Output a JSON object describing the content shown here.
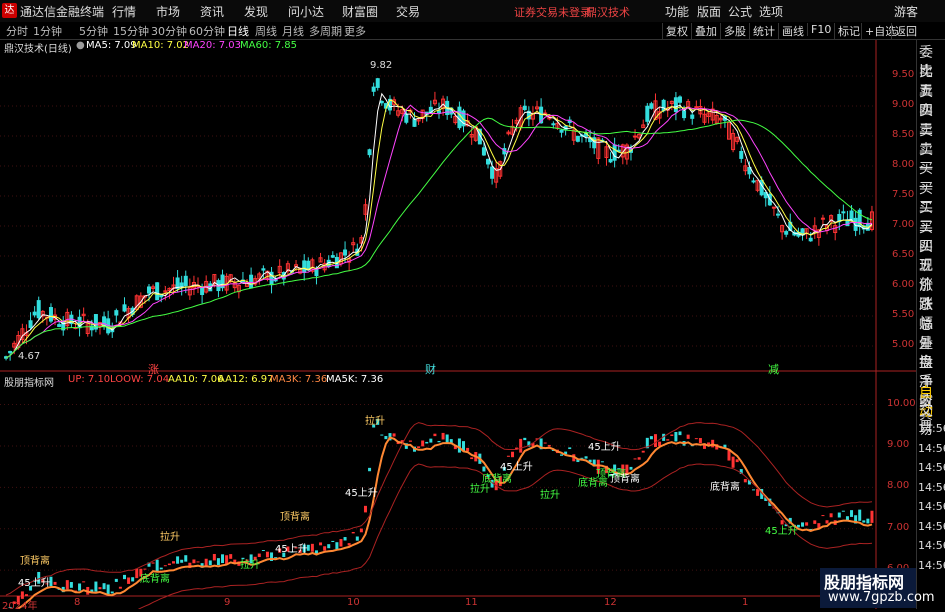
{
  "menubar": {
    "title": "通达信金融终端",
    "items": [
      "行情",
      "市场",
      "资讯",
      "发现",
      "问小达",
      "财富圈",
      "交易"
    ],
    "warning": "证券交易未登录",
    "brand": "鼎汉技术",
    "right_items": [
      "功能",
      "版面",
      "公式",
      "选项",
      "游客"
    ]
  },
  "toolbar": {
    "timeframes": [
      "分时",
      "1分钟",
      "5分钟",
      "15分钟",
      "30分钟",
      "60分钟",
      "日线",
      "周线",
      "月线",
      "多周期",
      "更多"
    ],
    "active": "日线",
    "buttons": [
      "复权",
      "叠加",
      "多股",
      "统计",
      "画线",
      "F10",
      "标记",
      "+自选",
      "返回"
    ]
  },
  "main_legend": {
    "stock": "鼎汉技术(日线)",
    "ma5": "MA5: 7.09",
    "ma10": "MA10: 7.02",
    "ma20": "MA20: 7.03",
    "ma60": "MA60: 7.85"
  },
  "sub_legend": {
    "name": "股朋指标网",
    "up": "UP: 7.10",
    "loow": "LOOW: 7.04",
    "aa10": "AA10: 7.06",
    "aa12": "AA12: 6.97",
    "ma3k": "MA3K: 7.36",
    "ma5k": "MA5K: 7.36"
  },
  "price_axis": [
    "9.50",
    "9.00",
    "8.50",
    "8.00",
    "7.50",
    "7.00",
    "6.50",
    "6.00",
    "5.50",
    "5.00"
  ],
  "sub_axis": [
    "10.00",
    "9.00",
    "8.00",
    "7.00",
    "6.00"
  ],
  "annotations": {
    "high": "9.82",
    "low": "4.67",
    "zhang": "涨",
    "cai": "财",
    "jian": "减"
  },
  "signals": [
    "顶背离",
    "45上升",
    "底背离",
    "拉升",
    "顶背离",
    "45上升",
    "拉升",
    "45上升",
    "拉升",
    "底背离",
    "45上升",
    "拉升",
    "底背离",
    "顶背离",
    "45上升",
    "底背离",
    "45上升",
    "拉升",
    "顶背离"
  ],
  "date_axis": [
    "2024年",
    "8",
    "9",
    "10",
    "11",
    "12",
    "1"
  ],
  "sidebar": [
    "委比",
    "卖五",
    "卖四",
    "卖三",
    "卖二",
    "卖一",
    "买一",
    "买二",
    "买三",
    "买四",
    "买五",
    "现价",
    "涨跌",
    "涨幅",
    "总量",
    "外盘",
    "换手",
    "净资",
    "收益"
  ],
  "sidebar2": [
    "自动",
    "交易"
  ],
  "times": [
    "14:56",
    "14:56",
    "14:56",
    "14:56",
    "14:56",
    "14:56",
    "14:56",
    "14:56"
  ],
  "watermark": {
    "title": "股朋指标网",
    "url": "www.7gpzb.com"
  },
  "colors": {
    "up": "#ff3333",
    "down": "#33dddd",
    "ma5": "#ffffff",
    "ma10": "#ffff44",
    "ma20": "#ff44ff",
    "ma60": "#44ff44"
  }
}
